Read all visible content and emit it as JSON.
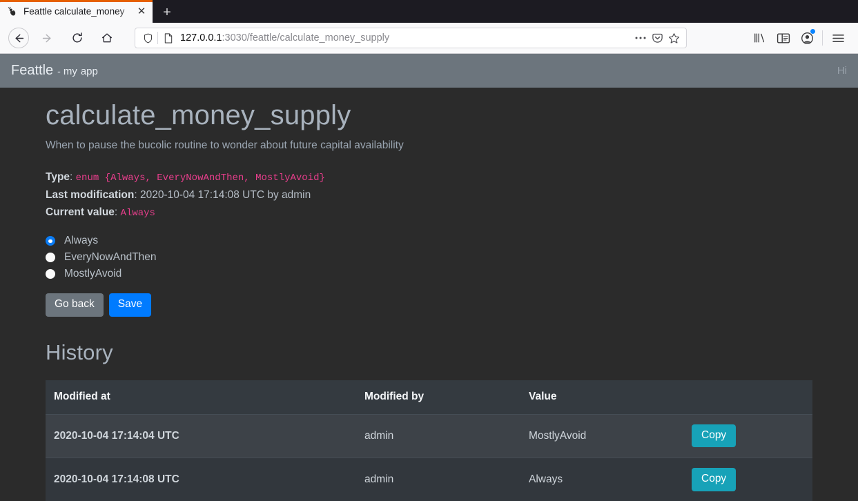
{
  "browser": {
    "tab": {
      "title": "Feattle calculate_money",
      "favicon": "bug-icon",
      "close_label": "✕"
    },
    "new_tab_label": "+",
    "nav": {
      "back": "back-arrow",
      "forward": "forward-arrow",
      "reload": "reload",
      "home": "home"
    },
    "url": {
      "host": "127.0.0.1",
      "rest": ":3030/feattle/calculate_money_supply",
      "full": "127.0.0.1:3030/feattle/calculate_money_supply"
    },
    "toolbar_icons": [
      "page-actions-icon",
      "pocket-icon",
      "bookmark-star-icon"
    ],
    "chrome_icons": [
      "library-icon",
      "sidebar-icon",
      "account-icon",
      "menu-icon"
    ]
  },
  "navbar": {
    "brand_main": "Feattle",
    "brand_dash": "-",
    "brand_sub_first": "my",
    "brand_sub_second": "app",
    "greeting": "Hi"
  },
  "page": {
    "title": "calculate_money_supply",
    "subtitle": "When to pause the bucolic routine to wonder about future capital availability",
    "meta": {
      "type_label": "Type",
      "type_sep": ": ",
      "type_value": "enum {Always, EveryNowAndThen, MostlyAvoid}",
      "last_mod_label": "Last modification",
      "last_mod_sep": ": ",
      "last_mod_value": "2020-10-04 17:14:08 UTC by admin",
      "current_label": "Current value",
      "current_sep": ": ",
      "current_value": "Always"
    },
    "options": [
      {
        "label": "Always",
        "checked": true
      },
      {
        "label": "EveryNowAndThen",
        "checked": false
      },
      {
        "label": "MostlyAvoid",
        "checked": false
      }
    ],
    "buttons": {
      "go_back": "Go back",
      "save": "Save"
    },
    "history_heading": "History",
    "history": {
      "columns": [
        "Modified at",
        "Modified by",
        "Value",
        ""
      ],
      "rows": [
        {
          "modified_at": "2020-10-04 17:14:04 UTC",
          "modified_by": "admin",
          "value": "MostlyAvoid",
          "action": "Copy"
        },
        {
          "modified_at": "2020-10-04 17:14:08 UTC",
          "modified_by": "admin",
          "value": "Always",
          "action": "Copy"
        }
      ]
    }
  },
  "colors": {
    "accent_orange": "#e66000",
    "navbar_bg": "#6c757d",
    "primary": "#007bff",
    "secondary": "#6c757d",
    "info": "#17a2b8",
    "code_pink": "#e83e8c",
    "page_bg": "#2b2b2b",
    "table_header_bg": "#343a40"
  }
}
